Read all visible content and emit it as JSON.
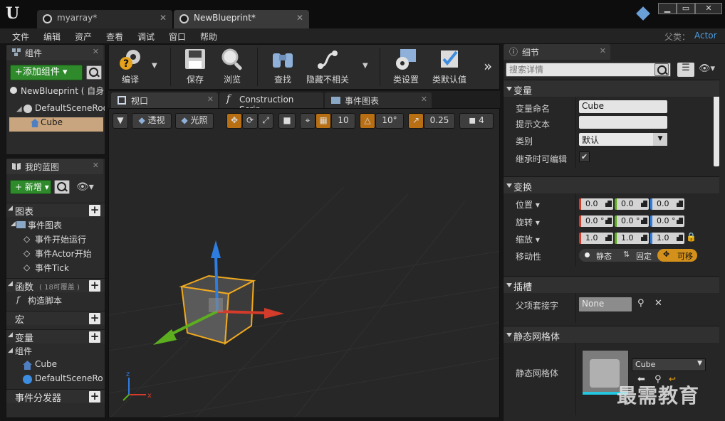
{
  "window": {
    "tabs": [
      {
        "label": "myarray*"
      },
      {
        "label": "NewBlueprint*"
      }
    ],
    "logo": "U"
  },
  "menu": {
    "items": [
      "文件",
      "编辑",
      "资产",
      "查看",
      "调试",
      "窗口",
      "帮助"
    ],
    "parent_label": "父类：",
    "parent_value": "Actor"
  },
  "components_panel": {
    "tab_label": "组件",
    "add_button": "+添加组件 ▾",
    "root_label": "NewBlueprint ( 自身",
    "scene_root": "DefaultSceneRoo",
    "cube": "Cube"
  },
  "my_blueprint": {
    "tab_label": "我的蓝图",
    "add_new": "新增",
    "sections": {
      "graphs": "图表",
      "event_graph": "事件图表",
      "event_begin": "事件开始运行",
      "event_actor": "事件Actor开始",
      "event_tick": "事件Tick",
      "functions": "函数",
      "functions_note": "( 18可覆盖 )",
      "construction": "构造脚本",
      "macros": "宏",
      "variables": "变量",
      "components": "组件",
      "comp_cube": "Cube",
      "comp_root": "DefaultSceneRo",
      "dispatchers": "事件分发器"
    }
  },
  "toolbar": {
    "compile": "编译",
    "save": "保存",
    "browse": "浏览",
    "find": "查找",
    "hide_unrelated": "隐藏不相关",
    "class_settings": "类设置",
    "class_defaults": "类默认值"
  },
  "viewport_tabs": {
    "viewport": "视口",
    "construction": "Construction Scrip",
    "event_graph": "事件图表"
  },
  "viewport": {
    "perspective": "透视",
    "lit": "光照",
    "grid_snap": "10",
    "rot_snap": "10°",
    "scale_snap": "0.25",
    "camera_speed": "4"
  },
  "details": {
    "tab_label": "细节",
    "search_placeholder": "搜索详情",
    "variable": {
      "section": "变量",
      "name_label": "变量命名",
      "name_value": "Cube",
      "tooltip_label": "提示文本",
      "tooltip_value": "",
      "category_label": "类别",
      "category_value": "默认",
      "editable_label": "继承时可编辑"
    },
    "transform": {
      "section": "变换",
      "location_label": "位置 ▾",
      "rotation_label": "旋转 ▾",
      "scale_label": "缩放 ▾",
      "mobility_label": "移动性",
      "location": [
        "0.0",
        "0.0",
        "0.0"
      ],
      "rotation": [
        "0.0 °",
        "0.0 °",
        "0.0 °"
      ],
      "scale": [
        "1.0",
        "1.0",
        "1.0"
      ],
      "mobility_static": "静态",
      "mobility_stationary": "固定",
      "mobility_movable": "可移"
    },
    "sockets": {
      "section": "插槽",
      "parent_socket_label": "父项套接字",
      "parent_socket_value": "None"
    },
    "static_mesh": {
      "section": "静态网格体",
      "mesh_label": "静态网格体",
      "mesh_value": "Cube"
    }
  },
  "watermark": "最需教育",
  "colors": {
    "green": "#2f8a2c",
    "orange": "#b86f13",
    "x_axis": "#d33b2a",
    "y_axis": "#5cae1f",
    "z_axis": "#2e7de0",
    "selection": "#f0a91e"
  }
}
